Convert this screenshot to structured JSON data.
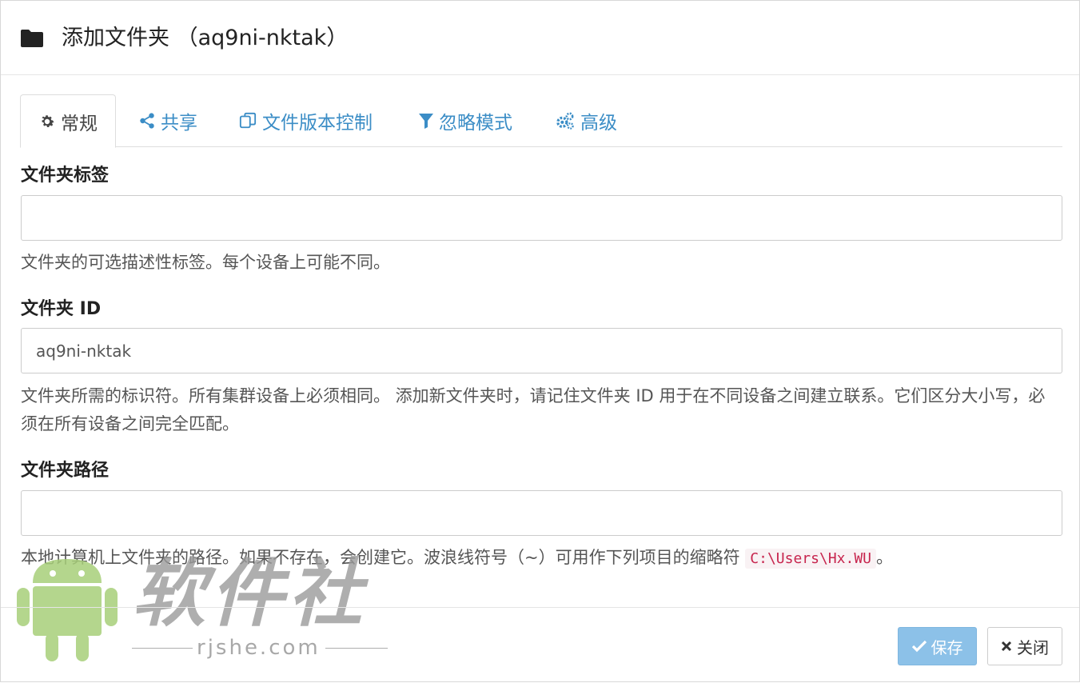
{
  "header": {
    "title": "添加文件夹 （aq9ni-nktak）",
    "icon": "folder-icon"
  },
  "tabs": [
    {
      "label": "常规",
      "icon": "gear-icon",
      "active": true
    },
    {
      "label": "共享",
      "icon": "share-icon",
      "active": false
    },
    {
      "label": "文件版本控制",
      "icon": "copy-icon",
      "active": false
    },
    {
      "label": "忽略模式",
      "icon": "filter-icon",
      "active": false
    },
    {
      "label": "高级",
      "icon": "cogs-icon",
      "active": false
    }
  ],
  "form": {
    "folder_label": {
      "label": "文件夹标签",
      "value": "",
      "help": "文件夹的可选描述性标签。每个设备上可能不同。"
    },
    "folder_id": {
      "label": "文件夹 ID",
      "value": "aq9ni-nktak",
      "help": "文件夹所需的标识符。所有集群设备上必须相同。 添加新文件夹时，请记住文件夹 ID 用于在不同设备之间建立联系。它们区分大小写，必须在所有设备之间完全匹配。"
    },
    "folder_path": {
      "label": "文件夹路径",
      "value": "",
      "help_prefix": "本地计算机上文件夹的路径。如果不存在，会创建它。波浪线符号（~）可用作下列项目的缩略符 ",
      "help_code": "C:\\Users\\Hx.WU",
      "help_suffix": "。"
    }
  },
  "footer": {
    "save_label": "保存",
    "close_label": "关闭"
  },
  "watermark": {
    "title": "软件社",
    "url": "rjshe.com"
  },
  "colors": {
    "accent": "#3b8dc6",
    "save_button": "#8cc1e8",
    "code_text": "#c7254e"
  }
}
